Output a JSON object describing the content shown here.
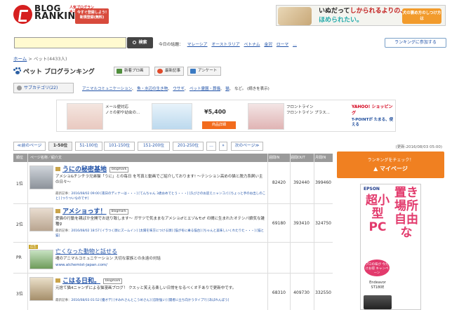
{
  "header": {
    "logo_line1": "BLOG",
    "logo_line2": "RANKING",
    "logo_sub": "人気ブログランキング",
    "register_badge": "今すぐ登録しよう! 新規登録(無料)",
    "top_ad": {
      "line1_a": "いぬだって",
      "line1_b": "しかられるよりの、",
      "line2": "ほめられたい。",
      "cta": "犬の褒め方のしつけ方は"
    }
  },
  "search": {
    "input_value": "",
    "button_label": "検索",
    "topics_label": "今日の話題：",
    "topics": [
      "マレーシア",
      "オーストラリア",
      "ベトナム",
      "金沢",
      "ローマ",
      "…"
    ],
    "join_button": "ランキングに参加する"
  },
  "breadcrumb": {
    "home": "ホーム",
    "sep": " > ",
    "current": "ペット",
    "count": "(4433人)"
  },
  "page": {
    "title": "ペット ブログランキング",
    "tabs": [
      "新着プロ画",
      "最新記事",
      "アンケート"
    ]
  },
  "subcategory": {
    "button": "サブカテゴリ(22)",
    "items": [
      "アニマルコミュニケーション",
      "魚・水辺の生き物",
      "ウサギ",
      "ペット霊園・葬儀",
      "猫",
      "など。"
    ],
    "more": "(続きを表示)"
  },
  "ad_strip": {
    "item1_text": [
      "メール便対応",
      "ノミの卵や幼虫の..."
    ],
    "item2_price": "¥5,400",
    "item2_detail": "商品詳細",
    "item3_text": [
      "フロントライン",
      "フロントライン プラス..."
    ],
    "yahoo_label": "YAHOO! ショッピング",
    "tpoint_label": "T-POINTが たまる、使える"
  },
  "pager": {
    "prev": "≪前のページ",
    "pages": [
      "1-50位",
      "51-100位",
      "101-150位",
      "151-200位",
      "201-250位",
      "…",
      "»"
    ],
    "next": "次のページ≫",
    "updated": "(更新:2016/08/03 05:00)"
  },
  "table": {
    "headers": [
      "順位",
      "ページ名称／紹介文",
      "週間IN",
      "週間OUT",
      "月間IN"
    ],
    "rows": [
      {
        "rank": "1位",
        "title": "うにの秘密基地",
        "desc": "アメショ&チンチラ兄弟猫「うに」との毎日 を写真と動画でご紹介しております! ～テンション高めの猫と脱力系飼い主の日々～",
        "meta_label": "最新記事：",
        "meta": "2016/08/02 09:00 [夜日のディナーは・・・] [てんちゃん 3歳おめでとう・・・] [久びさのお迎えニャンコ♪] [ちょっと手のお出しのこと] [つりついなのです]",
        "in": "82420",
        "out": "392440",
        "month": "399460"
      },
      {
        "rank": "2位",
        "title": "アメショっす！",
        "desc": "愛猫の行動を親ばか全開でお送り致します～ ガサツで気ままなアメショ♂とエゾ&モ♂ の間に生まれたオテンバ娘気な雑種♀",
        "meta_label": "最新記事：",
        "meta": "2016/08/02 18:57 [イラつく顔にズームイン] [太陽を味方につける顔] [猫が冬に乗る猫台] [ちゃんと美味しいくれたりた・・・] [猫と猫]",
        "in": "69180",
        "out": "393410",
        "month": "324750"
      },
      {
        "rank": "PR",
        "ad_badge": "広告",
        "title": "亡くなった動物と話せる",
        "desc": "魂のアニマルコミュニケーション 大切な家族との永遠の対話",
        "url": "www.alchemist-japan.com/",
        "in": "",
        "out": "",
        "month": ""
      },
      {
        "rank": "3位",
        "title": "こはる日和。",
        "desc": "元捨て猫4ニャンずによる猫漫画ブログ！ クスッと笑える楽しい日常をなるべくオチありで更新中です。",
        "meta_label": "最新記事：",
        "meta": "2016/08/03 01:52 [優オデ] [すみれさんとこうめさん] [忍耐強い] [闘者に立ち向かうタイプ?] [あばれんぼう]",
        "in": "68310",
        "out": "409730",
        "month": "332550"
      }
    ]
  },
  "right": {
    "mypage_top": "ランキングをチェック！",
    "mypage_label": "マイページ",
    "epson": {
      "brand": "EPSON",
      "big1": "置き場所自由な",
      "big2": "超小型PC",
      "badge": "プロの味が 今だけお得 キャンペーン",
      "model": "Endeavor ST180E"
    }
  },
  "colors": {
    "brand_red": "#d62020",
    "link": "#2253a8",
    "orange": "#f08021",
    "table_head": "#9a9a9a"
  }
}
